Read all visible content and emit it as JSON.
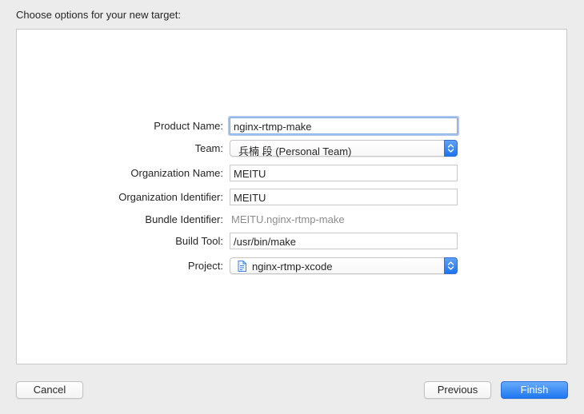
{
  "header": {
    "title": "Choose options for your new target:"
  },
  "form": {
    "product_name": {
      "label": "Product Name:",
      "value": "nginx-rtmp-make"
    },
    "team": {
      "label": "Team:",
      "value": "兵楠 段 (Personal Team)"
    },
    "organization_name": {
      "label": "Organization Name:",
      "value": "MEITU"
    },
    "organization_identifier": {
      "label": "Organization Identifier:",
      "value": "MEITU"
    },
    "bundle_identifier": {
      "label": "Bundle Identifier:",
      "value": "MEITU.nginx-rtmp-make"
    },
    "build_tool": {
      "label": "Build Tool:",
      "value": "/usr/bin/make"
    },
    "project": {
      "label": "Project:",
      "value": "nginx-rtmp-xcode",
      "icon": "project-file-icon"
    }
  },
  "footer": {
    "cancel_label": "Cancel",
    "previous_label": "Previous",
    "finish_label": "Finish"
  },
  "colors": {
    "accent": "#1e77f0",
    "background": "#ececec",
    "panel": "#ffffff"
  }
}
